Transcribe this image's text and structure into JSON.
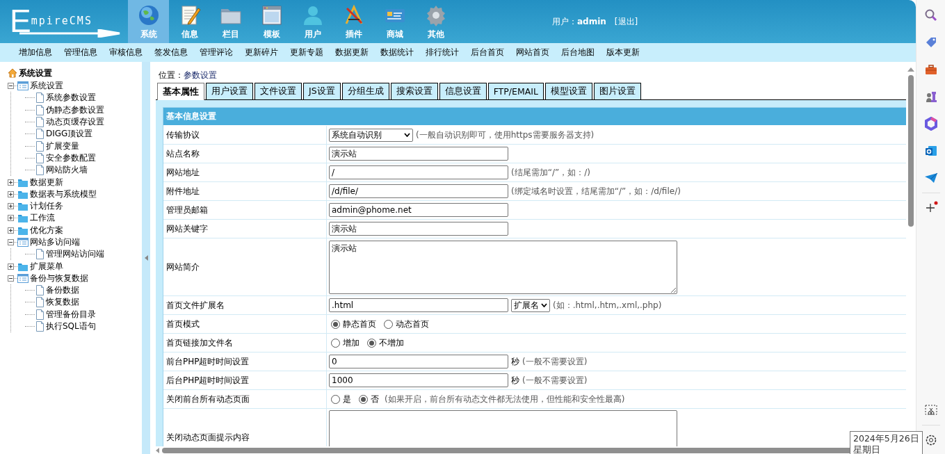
{
  "header": {
    "logo": "EmpireCMS",
    "nav": [
      {
        "label": "系统",
        "selected": true
      },
      {
        "label": "信息",
        "selected": false
      },
      {
        "label": "栏目",
        "selected": false
      },
      {
        "label": "模板",
        "selected": false
      },
      {
        "label": "用户",
        "selected": false
      },
      {
        "label": "插件",
        "selected": false
      },
      {
        "label": "商城",
        "selected": false
      },
      {
        "label": "其他",
        "selected": false
      }
    ],
    "user": "用户：**admin**",
    "logout": "[退出]"
  },
  "menu": [
    "增加信息",
    "管理信息",
    "审核信息",
    "签发信息",
    "管理评论",
    "更新碎片",
    "更新专题",
    "数据更新",
    "数据统计",
    "排行统计",
    "后台首页",
    "网站首页",
    "后台地图",
    "版本更新"
  ],
  "tree": {
    "title": "系统设置",
    "nodes": [
      {
        "label": "系统设置",
        "expanded": true,
        "children": [
          {
            "label": "系统参数设置"
          },
          {
            "label": "伪静态参数设置"
          },
          {
            "label": "动态页缓存设置"
          },
          {
            "label": "DIGG顶设置"
          },
          {
            "label": "扩展变量"
          },
          {
            "label": "安全参数配置"
          },
          {
            "label": "网站防火墙"
          }
        ]
      },
      {
        "label": "数据更新",
        "expanded": false
      },
      {
        "label": "数据表与系统模型",
        "expanded": false
      },
      {
        "label": "计划任务",
        "expanded": false
      },
      {
        "label": "工作流",
        "expanded": false
      },
      {
        "label": "优化方案",
        "expanded": false
      },
      {
        "label": "网站多访问端",
        "expanded": true,
        "children": [
          {
            "label": "管理网站访问端"
          }
        ]
      },
      {
        "label": "扩展菜单",
        "expanded": false
      },
      {
        "label": "备份与恢复数据",
        "expanded": true,
        "children": [
          {
            "label": "备份数据"
          },
          {
            "label": "恢复数据"
          },
          {
            "label": "管理备份目录"
          },
          {
            "label": "执行SQL语句"
          }
        ]
      }
    ]
  },
  "location": {
    "label": "位置：",
    "link": "参数设置"
  },
  "tabs": [
    {
      "label": "基本属性",
      "selected": true
    },
    {
      "label": "用户设置",
      "selected": false
    },
    {
      "label": "文件设置",
      "selected": false
    },
    {
      "label": "JS设置",
      "selected": false
    },
    {
      "label": "分组生成",
      "selected": false
    },
    {
      "label": "搜索设置",
      "selected": false
    },
    {
      "label": "信息设置",
      "selected": false
    },
    {
      "label": "FTP/EMAIL",
      "selected": false
    },
    {
      "label": "模型设置",
      "selected": false
    },
    {
      "label": "图片设置",
      "selected": false
    }
  ],
  "form": {
    "title": "基本信息设置",
    "rows": [
      {
        "label": "传输协议",
        "controls": [
          {
            "kind": "select",
            "value": "系统自动识别"
          },
          {
            "kind": "hint",
            "text": "(一般自动识别即可，使用https需要服务器支持)"
          }
        ]
      },
      {
        "label": "站点名称",
        "controls": [
          {
            "kind": "input",
            "value": "演示站"
          }
        ]
      },
      {
        "label": "网站地址",
        "controls": [
          {
            "kind": "input",
            "value": "/"
          },
          {
            "kind": "hint",
            "text": "(结尾需加“/”，如：/)"
          }
        ]
      },
      {
        "label": "附件地址",
        "controls": [
          {
            "kind": "input",
            "value": "/d/file/"
          },
          {
            "kind": "hint",
            "text": "(绑定域名时设置，结尾需加“/”，如：/d/file/)"
          }
        ]
      },
      {
        "label": "管理员邮箱",
        "controls": [
          {
            "kind": "input",
            "value": "admin@phome.net"
          }
        ]
      },
      {
        "label": "网站关键字",
        "controls": [
          {
            "kind": "input",
            "value": "演示站"
          }
        ]
      },
      {
        "label": "网站简介",
        "controls": [
          {
            "kind": "textarea",
            "value": "演示站"
          }
        ]
      },
      {
        "label": "首页文件扩展名",
        "controls": [
          {
            "kind": "input",
            "value": ".html"
          },
          {
            "kind": "select",
            "value": "扩展名"
          },
          {
            "kind": "hint",
            "text": "(如：.html,.htm,.xml,.php)"
          }
        ]
      },
      {
        "label": "首页模式",
        "controls": [
          {
            "kind": "radio",
            "label": "静态首页",
            "selected": true
          },
          {
            "kind": "radio",
            "label": "动态首页",
            "selected": false
          }
        ]
      },
      {
        "label": "首页链接加文件名",
        "controls": [
          {
            "kind": "radio",
            "label": "增加",
            "selected": false
          },
          {
            "kind": "radio",
            "label": "不增加",
            "selected": true
          }
        ]
      },
      {
        "label": "前台PHP超时时间设置",
        "controls": [
          {
            "kind": "input",
            "value": "0"
          },
          {
            "kind": "unit",
            "text": "秒"
          },
          {
            "kind": "hint",
            "text": "(一般不需要设置)"
          }
        ]
      },
      {
        "label": "后台PHP超时时间设置",
        "controls": [
          {
            "kind": "input",
            "value": "1000"
          },
          {
            "kind": "unit",
            "text": "秒"
          },
          {
            "kind": "hint",
            "text": "(一般不需要设置)"
          }
        ]
      },
      {
        "label": "关闭前台所有动态页面",
        "controls": [
          {
            "kind": "radio",
            "label": "是",
            "selected": false
          },
          {
            "kind": "radio",
            "label": "否",
            "selected": true
          },
          {
            "kind": "hint",
            "text": "(如果开启，前台所有动态文件都无法使用，但性能和安全性最高)"
          }
        ]
      },
      {
        "label": "关闭动态页面提示内容",
        "controls": [
          {
            "kind": "textarea"
          }
        ]
      }
    ]
  },
  "tooltip": {
    "date": "2024年5月26日",
    "weekday": "星期日"
  }
}
